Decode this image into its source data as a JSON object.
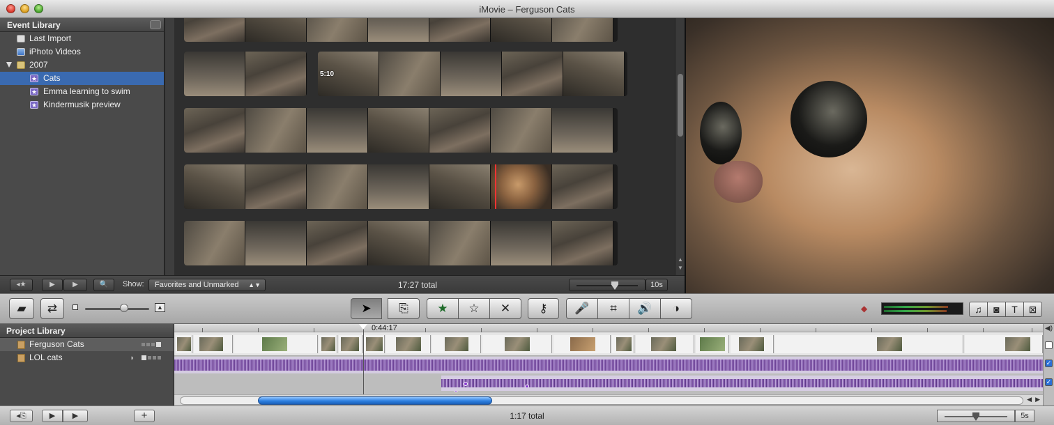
{
  "window": {
    "title": "iMovie – Ferguson Cats"
  },
  "event_library": {
    "header": "Event Library",
    "items": [
      {
        "label": "Last Import",
        "icon": "import-icon"
      },
      {
        "label": "iPhoto Videos",
        "icon": "iphoto-icon"
      },
      {
        "label": "2007",
        "icon": "folder-icon"
      },
      {
        "label": "Cats",
        "icon": "event-star-icon",
        "selected": true
      },
      {
        "label": "Emma learning to swim",
        "icon": "event-star-icon"
      },
      {
        "label": "Kindermusik preview",
        "icon": "event-star-icon"
      }
    ]
  },
  "event_browser": {
    "clip_duration_badge": "5:10",
    "toolbar": {
      "show_label": "Show:",
      "show_value": "Favorites and Unmarked",
      "total": "17:27 total",
      "zoom_value": "10s"
    }
  },
  "main_toolbar": {
    "buttons": [
      "camera-import",
      "swap-events-projects",
      "arrow-tool",
      "add-to-project",
      "mark-favorite",
      "unmark",
      "reject",
      "keyword",
      "voiceover",
      "crop",
      "audio-adjust",
      "video-adjust",
      "music-effects",
      "photos",
      "titles",
      "transitions"
    ],
    "thumbnail_size_fraction": 0.55
  },
  "project_library": {
    "header": "Project Library",
    "projects": [
      {
        "label": "Ferguson Cats",
        "selected": true
      },
      {
        "label": "LOL cats",
        "selected": false
      }
    ]
  },
  "timeline": {
    "playhead_time": "0:44:17",
    "total": "1:17 total",
    "zoom_value": "5s"
  },
  "colors": {
    "selection": "#3a6ab0",
    "audio_waveform": "#7a4fa3",
    "scroll_thumb": "#2d7fe0"
  }
}
